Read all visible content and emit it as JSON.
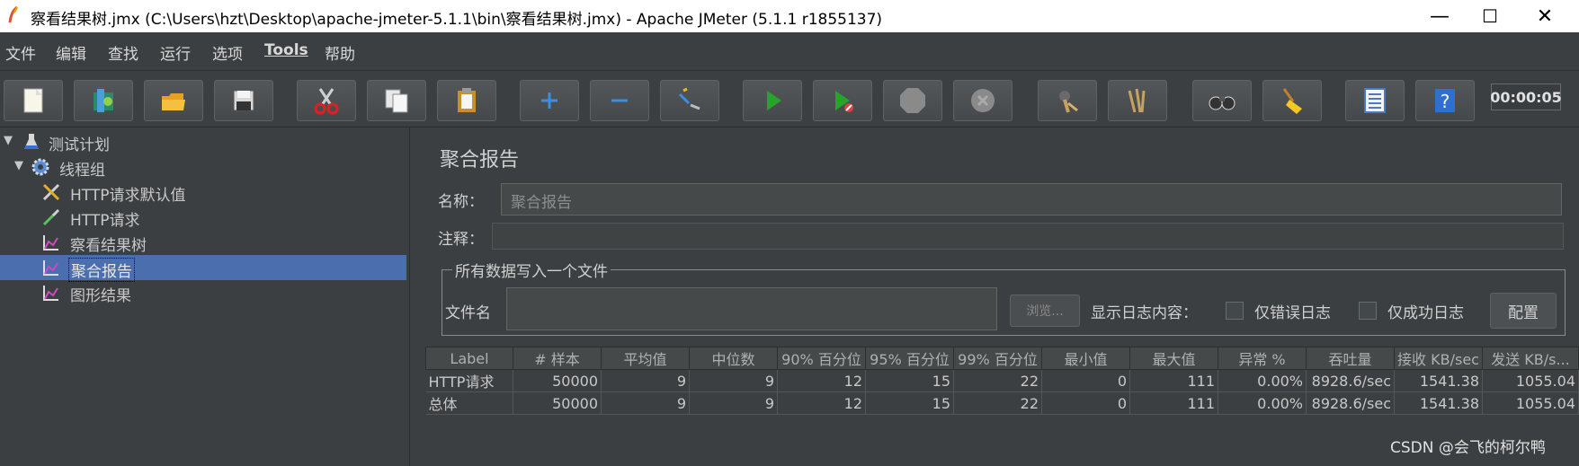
{
  "window": {
    "title": "察看结果树.jmx (C:\\Users\\hzt\\Desktop\\apache-jmeter-5.1.1\\bin\\察看结果树.jmx) - Apache JMeter (5.1.1 r1855137)",
    "minimize": "—",
    "maximize": "☐",
    "close": "✕"
  },
  "menu": [
    "文件",
    "编辑",
    "查找",
    "运行",
    "选项",
    "Tools",
    "帮助"
  ],
  "toolbar": {
    "buttons": [
      "new-icon",
      "templates-icon",
      "open-icon",
      "save-icon",
      "cut-icon",
      "copy-icon",
      "paste-icon",
      "expand-icon",
      "collapse-icon",
      "toggle-icon",
      "start-icon",
      "start-no-pause-icon",
      "stop-icon",
      "shutdown-icon",
      "clear-icon",
      "clear-all-icon",
      "search-icon",
      "reset-search-icon",
      "function-helper-icon",
      "help-icon"
    ],
    "timer": "00:00:05"
  },
  "tree": {
    "items": [
      {
        "label": "测试计划",
        "icon": "flask-icon",
        "expanded": true
      },
      {
        "label": "线程组",
        "icon": "gear-icon",
        "expanded": true
      },
      {
        "label": "HTTP请求默认值",
        "icon": "tools-icon"
      },
      {
        "label": "HTTP请求",
        "icon": "pipette-icon"
      },
      {
        "label": "察看结果树",
        "icon": "chart-icon"
      },
      {
        "label": "聚合报告",
        "icon": "chart-icon",
        "selected": true
      },
      {
        "label": "图形结果",
        "icon": "chart-icon"
      }
    ]
  },
  "panel": {
    "title": "聚合报告",
    "name_label": "名称：",
    "name_value": "聚合报告",
    "comment_label": "注释：",
    "file_section": "所有数据写入一个文件",
    "filename_label": "文件名",
    "browse": "浏览...",
    "log_label": "显示日志内容：",
    "errors_only": "仅错误日志",
    "success_only": "仅成功日志",
    "configure": "配置"
  },
  "table": {
    "headers": [
      "Label",
      "# 样本",
      "平均值",
      "中位数",
      "90% 百分位",
      "95% 百分位",
      "99% 百分位",
      "最小值",
      "最大值",
      "异常 %",
      "吞吐量",
      "接收 KB/sec",
      "发送 KB/s..."
    ],
    "rows": [
      [
        "HTTP请求",
        "50000",
        "9",
        "9",
        "12",
        "15",
        "22",
        "0",
        "111",
        "0.00%",
        "8928.6/sec",
        "1541.38",
        "1055.04"
      ],
      [
        "总体",
        "50000",
        "9",
        "9",
        "12",
        "15",
        "22",
        "0",
        "111",
        "0.00%",
        "8928.6/sec",
        "1541.38",
        "1055.04"
      ]
    ]
  },
  "watermark": "CSDN @会飞的柯尔鸭",
  "colors": {
    "selection": "#4b6eaf",
    "background": "#3c3f41",
    "start_green": "#29a329"
  }
}
